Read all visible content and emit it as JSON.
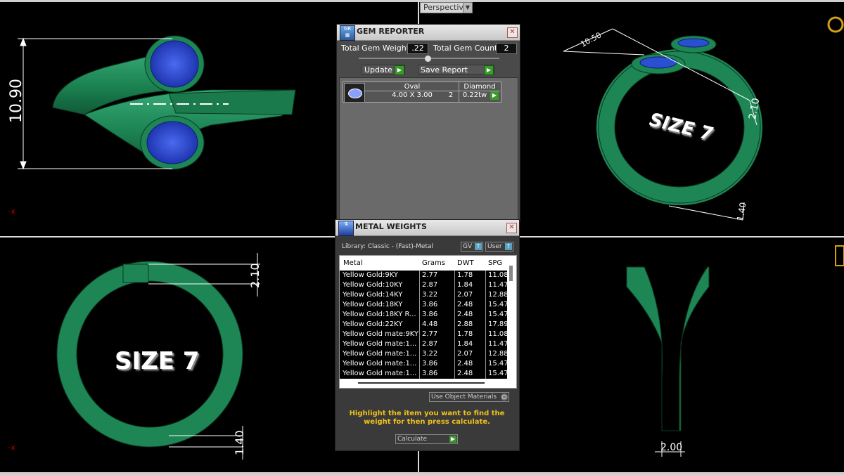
{
  "viewport": {
    "mode": "Perspective"
  },
  "dimensions": {
    "top_left_height": "10.90",
    "top_right_length": "10.50",
    "top_right_thick": "2.10",
    "top_right_bottom": "1.40",
    "bottom_left_top": "2.10",
    "bottom_left_bottom": "1.40",
    "bottom_right_width": "2.00"
  },
  "ring_label": "SIZE 7",
  "gem_reporter": {
    "title": "GEM REPORTER",
    "total_gem_weight_label": "Total Gem Weight",
    "total_gem_weight": ".22",
    "total_gem_count_label": "Total Gem Count",
    "total_gem_count": "2",
    "update_label": "Update",
    "save_report_label": "Save Report",
    "gems": [
      {
        "shape": "Oval",
        "size": "4.00 X 3.00",
        "material": "Diamond",
        "count": "2",
        "weight": "0.22tw"
      }
    ]
  },
  "metal_weights": {
    "title": "METAL WEIGHTS",
    "library": "Library: Classic - (Fast)-Metal",
    "gv_label": "GV",
    "user_label": "User",
    "columns": [
      "Metal",
      "Grams",
      "DWT",
      "SPG"
    ],
    "rows": [
      [
        "Yellow Gold:9KY",
        "2.77",
        "1.78",
        "11.08"
      ],
      [
        "Yellow Gold:10KY",
        "2.87",
        "1.84",
        "11.47"
      ],
      [
        "Yellow Gold:14KY",
        "3.22",
        "2.07",
        "12.88"
      ],
      [
        "Yellow Gold:18KY",
        "3.86",
        "2.48",
        "15.47"
      ],
      [
        "Yellow Gold:18KY R...",
        "3.86",
        "2.48",
        "15.47"
      ],
      [
        "Yellow Gold:22KY",
        "4.48",
        "2.88",
        "17.89"
      ],
      [
        "Yellow Gold mate:9KY",
        "2.77",
        "1.78",
        "11.08"
      ],
      [
        "Yellow Gold mate:1...",
        "2.87",
        "1.84",
        "11.47"
      ],
      [
        "Yellow Gold mate:1...",
        "3.22",
        "2.07",
        "12.88"
      ],
      [
        "Yellow Gold mate:1...",
        "3.86",
        "2.48",
        "15.47"
      ],
      [
        "Yellow Gold mate:1...",
        "3.86",
        "2.48",
        "15.47"
      ]
    ],
    "use_object_materials": "Use Object Materials",
    "hint": "Highlight the item you want to find the weight for then press calculate.",
    "calculate_label": "Calculate"
  },
  "colors": {
    "ring_green": "#1f8a5a",
    "gem_blue": "#2a4fd0",
    "hint_yellow": "#f2c31a"
  }
}
